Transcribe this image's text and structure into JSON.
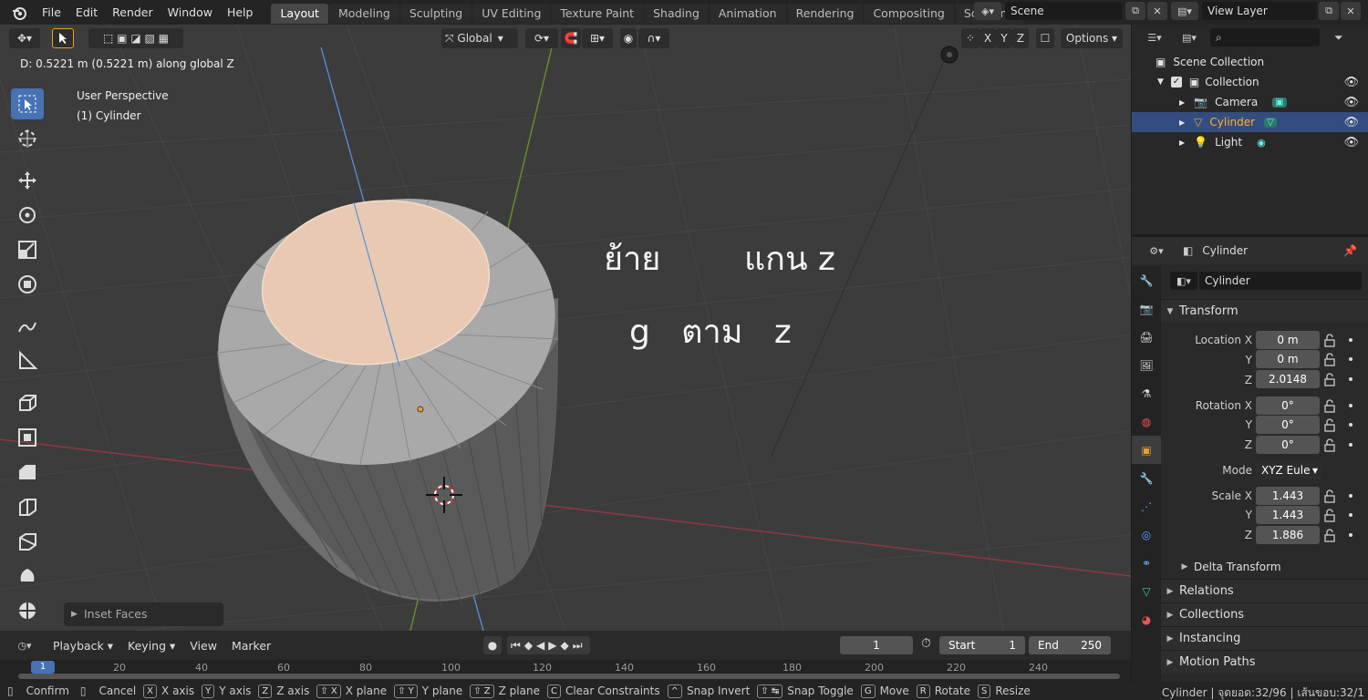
{
  "topbar": {
    "menus": [
      "File",
      "Edit",
      "Render",
      "Window",
      "Help"
    ],
    "workspaces": [
      "Layout",
      "Modeling",
      "Sculpting",
      "UV Editing",
      "Texture Paint",
      "Shading",
      "Animation",
      "Rendering",
      "Compositing",
      "Scripting"
    ],
    "active_workspace": "Layout",
    "scene": "Scene",
    "view_layer": "View Layer"
  },
  "viewport": {
    "orientation": "Global",
    "axes": [
      "X",
      "Y",
      "Z"
    ],
    "options_label": "Options",
    "drag_info": "D: 0.5221 m (0.5221 m) along global Z",
    "perspective": "User Perspective",
    "object_label": "(1) Cylinder",
    "overlay_line1": "ย้าย        แกน z",
    "overlay_line2": "g   ตาม   z",
    "last_operator": "Inset Faces"
  },
  "timeline": {
    "menus": [
      "Playback",
      "Keying",
      "View",
      "Marker"
    ],
    "current_frame": "1",
    "start_label": "Start",
    "start": "1",
    "end_label": "End",
    "end": "250",
    "ruler": [
      "1",
      "20",
      "40",
      "60",
      "80",
      "100",
      "120",
      "140",
      "160",
      "180",
      "200",
      "220",
      "240"
    ]
  },
  "statusbar": {
    "items": [
      {
        "key": "",
        "label": "Confirm"
      },
      {
        "key": "",
        "label": "Cancel"
      },
      {
        "key": "X",
        "label": "X axis"
      },
      {
        "key": "Y",
        "label": "Y axis"
      },
      {
        "key": "Z",
        "label": "Z axis"
      },
      {
        "key": "⇧ X",
        "label": "X plane"
      },
      {
        "key": "⇧ Y",
        "label": "Y plane"
      },
      {
        "key": "⇧ Z",
        "label": "Z plane"
      },
      {
        "key": "C",
        "label": "Clear Constraints"
      },
      {
        "key": "^",
        "label": "Snap Invert"
      },
      {
        "key": "⇧ ↹",
        "label": "Snap Toggle"
      },
      {
        "key": "G",
        "label": "Move"
      },
      {
        "key": "R",
        "label": "Rotate"
      },
      {
        "key": "S",
        "label": "Resize"
      }
    ],
    "right": "Cylinder | จุดยอด:32/96 | เส้นขอบ:32/1"
  },
  "outliner": {
    "root": "Scene Collection",
    "collection": "Collection",
    "items": [
      "Camera",
      "Cylinder",
      "Light"
    ],
    "selected": "Cylinder"
  },
  "properties": {
    "object_name": "Cylinder",
    "data_name": "Cylinder",
    "transform_label": "Transform",
    "location_label": "Location X",
    "rotation_label": "Rotation X",
    "scale_label": "Scale X",
    "axis_y": "Y",
    "axis_z": "Z",
    "location": [
      "0 m",
      "0 m",
      "2.0148"
    ],
    "rotation": [
      "0°",
      "0°",
      "0°"
    ],
    "mode_label": "Mode",
    "mode": "XYZ Eule",
    "scale": [
      "1.443",
      "1.443",
      "1.886"
    ],
    "sections": [
      "Delta Transform",
      "Relations",
      "Collections",
      "Instancing",
      "Motion Paths"
    ]
  },
  "colors": {
    "accent": "#4772b3",
    "selected_row": "#334d80",
    "active_text": "#ffaf29",
    "viewport_bg": "#3c3c3c"
  }
}
